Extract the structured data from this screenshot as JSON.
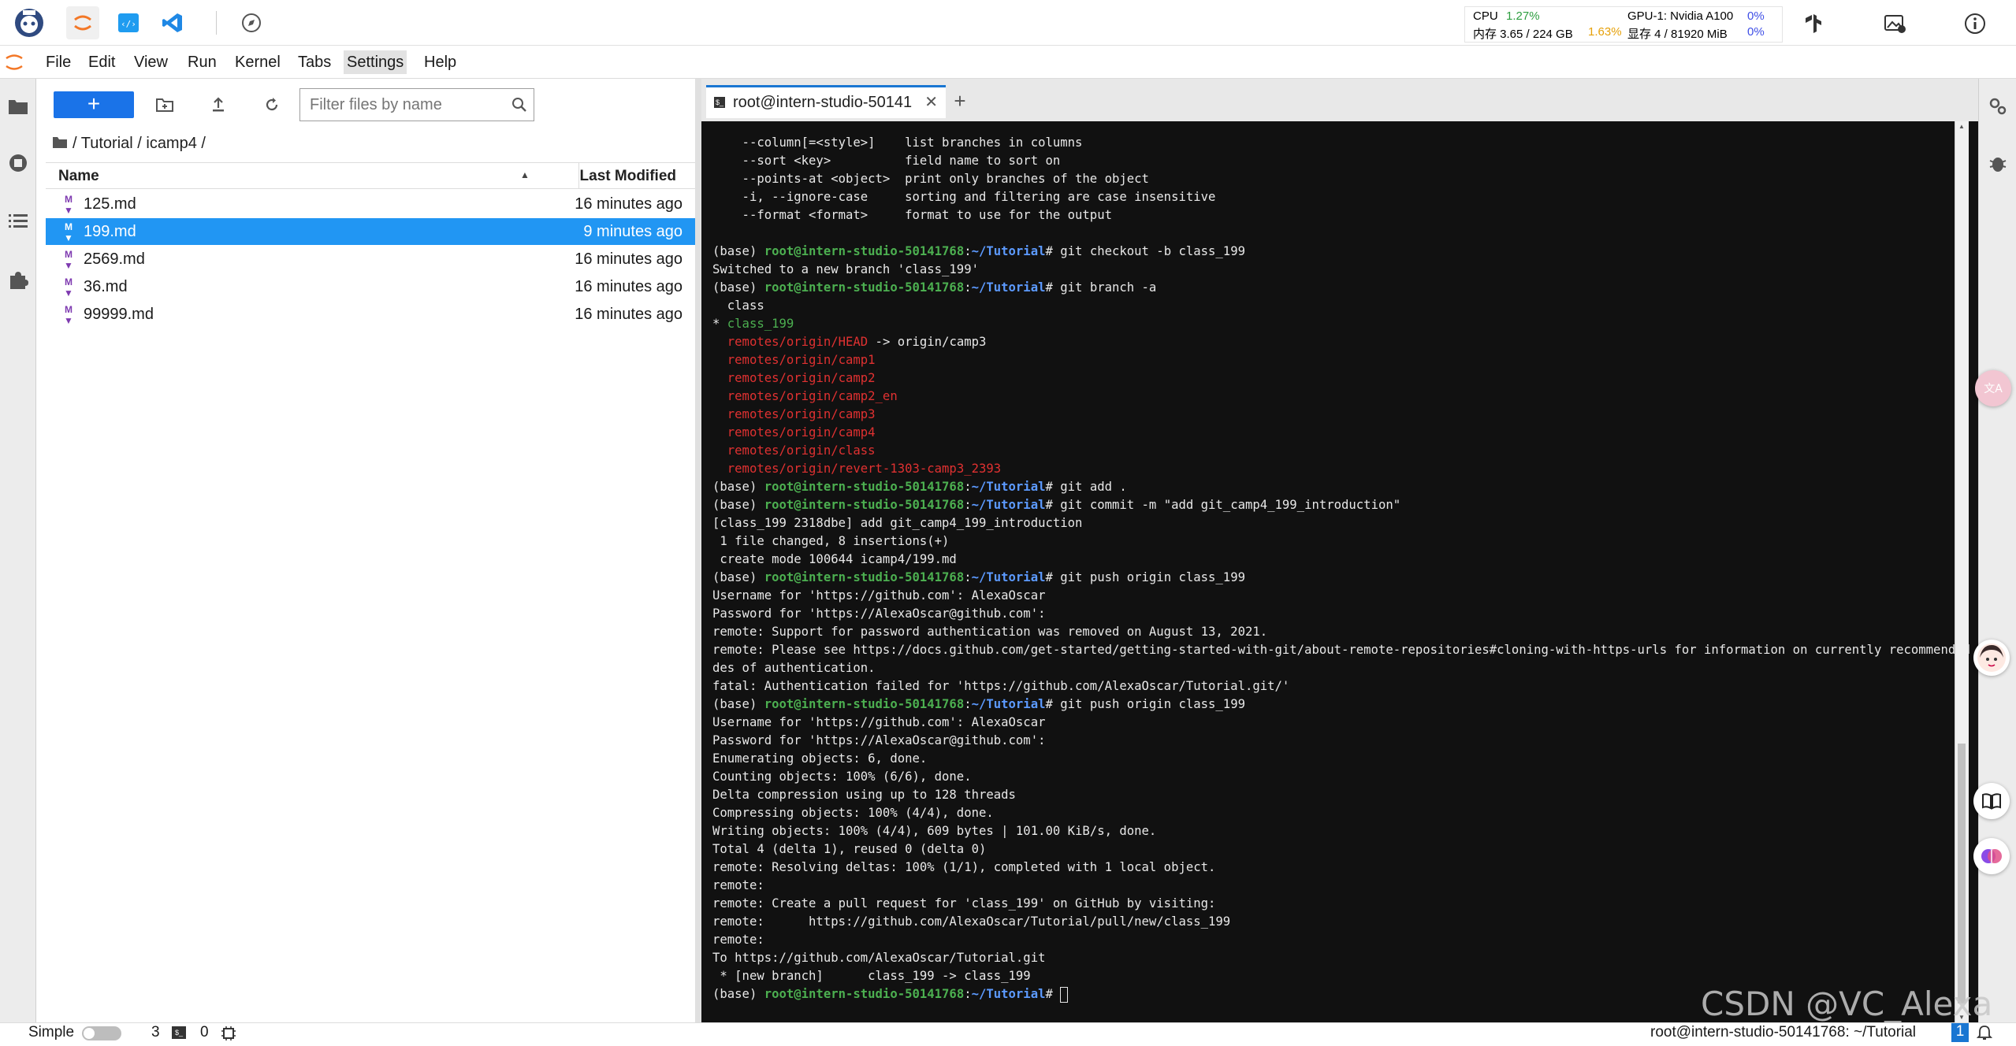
{
  "topbar": {
    "stats": {
      "cpu_label": "CPU",
      "cpu_value": "1.27%",
      "mem_label": "内存 3.65 / 224 GB",
      "mem_value": "1.63%",
      "gpu_label": "GPU-1: Nvidia A100",
      "gpu_value": "0%",
      "vram_label": "显存 4 / 81920 MiB",
      "vram_value": "0%"
    },
    "colors": {
      "cpu": "#2e9e40",
      "mem": "#e6a10a",
      "gpu": "#3f4fe6"
    }
  },
  "menu": {
    "items": [
      "File",
      "Edit",
      "View",
      "Run",
      "Kernel",
      "Tabs",
      "Settings",
      "Help"
    ],
    "active": "Settings"
  },
  "filebrowser": {
    "new_label": "+",
    "search_placeholder": "Filter files by name",
    "breadcrumb": "/ Tutorial / icamp4 /",
    "col_name": "Name",
    "col_modified": "Last Modified",
    "files": [
      {
        "name": "125.md",
        "modified": "16 minutes ago"
      },
      {
        "name": "199.md",
        "modified": "9 minutes ago"
      },
      {
        "name": "2569.md",
        "modified": "16 minutes ago"
      },
      {
        "name": "36.md",
        "modified": "16 minutes ago"
      },
      {
        "name": "99999.md",
        "modified": "16 minutes ago"
      }
    ],
    "selected_index": 1
  },
  "tab": {
    "label": "root@intern-studio-50141",
    "close": "✕",
    "add": "+"
  },
  "terminal": {
    "prompt_env": "(base)",
    "prompt_user": "root@intern-studio-50141768",
    "prompt_path": "~/Tutorial",
    "lines": [
      [
        [
          "    --column[=<style>]    list branches in columns",
          ""
        ]
      ],
      [
        [
          "    --sort <key>          field name to sort on",
          ""
        ]
      ],
      [
        [
          "    --points-at <object>  print only branches of the object",
          ""
        ]
      ],
      [
        [
          "    -i, --ignore-case     sorting and filtering are case insensitive",
          ""
        ]
      ],
      [
        [
          "    --format <format>     format to use for the output",
          ""
        ]
      ],
      [
        [
          "",
          ""
        ]
      ],
      [
        [
          "(base) ",
          ""
        ],
        [
          "root@intern-studio-50141768",
          "g"
        ],
        [
          ":",
          ""
        ],
        [
          "~/Tutorial",
          "b"
        ],
        [
          "# git checkout -b class_199",
          ""
        ]
      ],
      [
        [
          "Switched to a new branch 'class_199'",
          ""
        ]
      ],
      [
        [
          "(base) ",
          ""
        ],
        [
          "root@intern-studio-50141768",
          "g"
        ],
        [
          ":",
          ""
        ],
        [
          "~/Tutorial",
          "b"
        ],
        [
          "# git branch -a",
          ""
        ]
      ],
      [
        [
          "  class",
          ""
        ]
      ],
      [
        [
          "* ",
          ""
        ],
        [
          "class_199",
          "gr"
        ]
      ],
      [
        [
          "  ",
          ""
        ],
        [
          "remotes/origin/HEAD",
          "r"
        ],
        [
          " -> origin/camp3",
          ""
        ]
      ],
      [
        [
          "  ",
          ""
        ],
        [
          "remotes/origin/camp1",
          "r"
        ]
      ],
      [
        [
          "  ",
          ""
        ],
        [
          "remotes/origin/camp2",
          "r"
        ]
      ],
      [
        [
          "  ",
          ""
        ],
        [
          "remotes/origin/camp2_en",
          "r"
        ]
      ],
      [
        [
          "  ",
          ""
        ],
        [
          "remotes/origin/camp3",
          "r"
        ]
      ],
      [
        [
          "  ",
          ""
        ],
        [
          "remotes/origin/camp4",
          "r"
        ]
      ],
      [
        [
          "  ",
          ""
        ],
        [
          "remotes/origin/class",
          "r"
        ]
      ],
      [
        [
          "  ",
          ""
        ],
        [
          "remotes/origin/revert-1303-camp3_2393",
          "r"
        ]
      ],
      [
        [
          "(base) ",
          ""
        ],
        [
          "root@intern-studio-50141768",
          "g"
        ],
        [
          ":",
          ""
        ],
        [
          "~/Tutorial",
          "b"
        ],
        [
          "# git add .",
          ""
        ]
      ],
      [
        [
          "(base) ",
          ""
        ],
        [
          "root@intern-studio-50141768",
          "g"
        ],
        [
          ":",
          ""
        ],
        [
          "~/Tutorial",
          "b"
        ],
        [
          "# git commit -m \"add git_camp4_199_introduction\"",
          ""
        ]
      ],
      [
        [
          "[class_199 2318dbe] add git_camp4_199_introduction",
          ""
        ]
      ],
      [
        [
          " 1 file changed, 8 insertions(+)",
          ""
        ]
      ],
      [
        [
          " create mode 100644 icamp4/199.md",
          ""
        ]
      ],
      [
        [
          "(base) ",
          ""
        ],
        [
          "root@intern-studio-50141768",
          "g"
        ],
        [
          ":",
          ""
        ],
        [
          "~/Tutorial",
          "b"
        ],
        [
          "# git push origin class_199",
          ""
        ]
      ],
      [
        [
          "Username for 'https://github.com': AlexaOscar",
          ""
        ]
      ],
      [
        [
          "Password for 'https://AlexaOscar@github.com':",
          ""
        ]
      ],
      [
        [
          "remote: Support for password authentication was removed on August 13, 2021.",
          ""
        ]
      ],
      [
        [
          "remote: Please see https://docs.github.com/get-started/getting-started-with-git/about-remote-repositories#cloning-with-https-urls for information on currently recommended mo",
          ""
        ]
      ],
      [
        [
          "des of authentication.",
          ""
        ]
      ],
      [
        [
          "fatal: Authentication failed for 'https://github.com/AlexaOscar/Tutorial.git/'",
          ""
        ]
      ],
      [
        [
          "(base) ",
          ""
        ],
        [
          "root@intern-studio-50141768",
          "g"
        ],
        [
          ":",
          ""
        ],
        [
          "~/Tutorial",
          "b"
        ],
        [
          "# git push origin class_199",
          ""
        ]
      ],
      [
        [
          "Username for 'https://github.com': AlexaOscar",
          ""
        ]
      ],
      [
        [
          "Password for 'https://AlexaOscar@github.com':",
          ""
        ]
      ],
      [
        [
          "Enumerating objects: 6, done.",
          ""
        ]
      ],
      [
        [
          "Counting objects: 100% (6/6), done.",
          ""
        ]
      ],
      [
        [
          "Delta compression using up to 128 threads",
          ""
        ]
      ],
      [
        [
          "Compressing objects: 100% (4/4), done.",
          ""
        ]
      ],
      [
        [
          "Writing objects: 100% (4/4), 609 bytes | 101.00 KiB/s, done.",
          ""
        ]
      ],
      [
        [
          "Total 4 (delta 1), reused 0 (delta 0)",
          ""
        ]
      ],
      [
        [
          "remote: Resolving deltas: 100% (1/1), completed with 1 local object.",
          ""
        ]
      ],
      [
        [
          "remote:",
          ""
        ]
      ],
      [
        [
          "remote: Create a pull request for 'class_199' on GitHub by visiting:",
          ""
        ]
      ],
      [
        [
          "remote:      https://github.com/AlexaOscar/Tutorial/pull/new/class_199",
          ""
        ]
      ],
      [
        [
          "remote:",
          ""
        ]
      ],
      [
        [
          "To https://github.com/AlexaOscar/Tutorial.git",
          ""
        ]
      ],
      [
        [
          " * [new branch]      class_199 -> class_199",
          ""
        ]
      ],
      [
        [
          "(base) ",
          ""
        ],
        [
          "root@intern-studio-50141768",
          "g"
        ],
        [
          ":",
          ""
        ],
        [
          "~/Tutorial",
          "b"
        ],
        [
          "# ",
          ""
        ]
      ]
    ]
  },
  "statusbar": {
    "mode": "Simple",
    "count1": "3",
    "count2": "0",
    "right_text": "root@intern-studio-50141768: ~/Tutorial",
    "notif_count": "1"
  },
  "watermark": "CSDN @VC_Alexa",
  "icons": {
    "apps": [
      "bot-avatar-icon",
      "jupyter-icon",
      "vscode-web-icon",
      "vscode-icon",
      "compass-icon"
    ],
    "top_right": [
      "tensorboard-icon",
      "image-settings-icon",
      "info-icon"
    ]
  }
}
